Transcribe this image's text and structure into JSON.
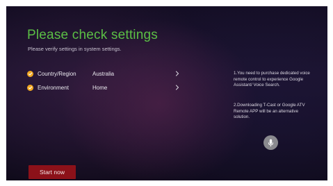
{
  "page": {
    "title": "Please check settings",
    "subtitle": "Please verify settings in system settings."
  },
  "settings": [
    {
      "label": "Country/Region",
      "value": "Australia",
      "status_icon": "check-circle-icon",
      "nav_icon": "chevron-right-icon"
    },
    {
      "label": "Environment",
      "value": "Home",
      "status_icon": "check-circle-icon",
      "nav_icon": "chevron-right-icon"
    }
  ],
  "info": {
    "note_1": "1.You need to purchase dedicated voice remote control to experience Google Assistant/ Voice Search.",
    "note_2": "2.Downloading T-Cast or Google ATV Remote APP will be an alternative solution."
  },
  "mic": {
    "icon": "microphone-icon"
  },
  "actions": {
    "start_label": "Start now"
  },
  "colors": {
    "title_green": "#5bbf45",
    "check_orange": "#f0a721",
    "button_red": "#8c1119",
    "background": "#1a1229"
  }
}
